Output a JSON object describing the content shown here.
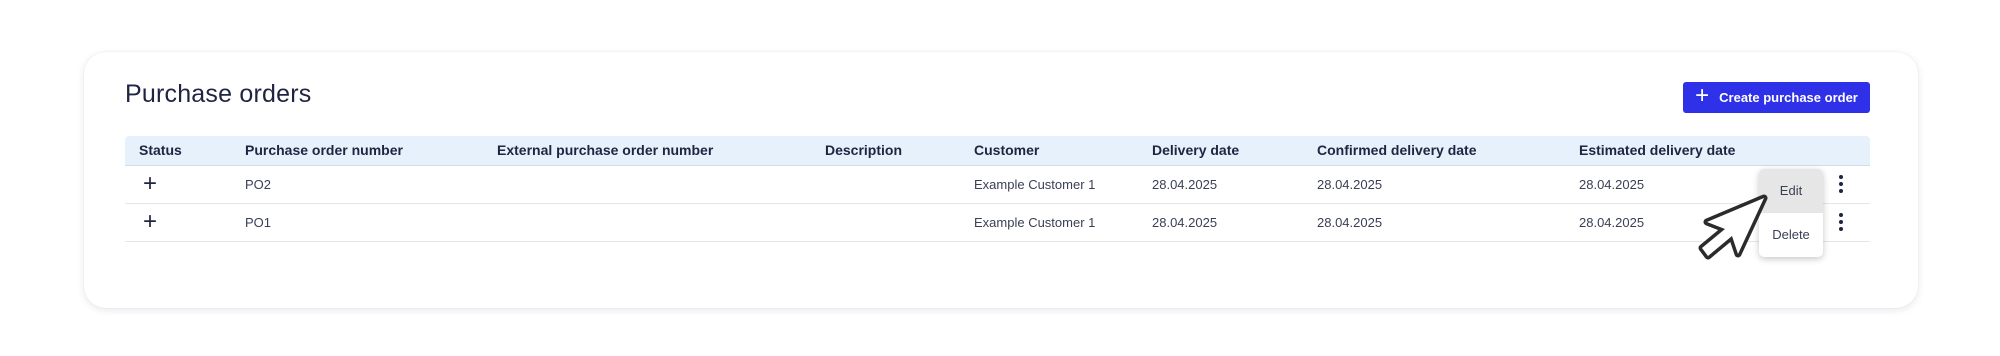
{
  "page": {
    "title": "Purchase orders",
    "create_button_label": "Create purchase order",
    "create_button_icon": "plus-icon"
  },
  "table": {
    "columns": [
      "Status",
      "Purchase order number",
      "External purchase order number",
      "Description",
      "Customer",
      "Delivery date",
      "Confirmed delivery date",
      "Estimated delivery date"
    ],
    "rows": [
      {
        "status_icon": "plus-icon",
        "purchase_order_number": "PO2",
        "external_purchase_order_number": "",
        "description": "",
        "customer": "Example Customer 1",
        "delivery_date": "28.04.2025",
        "confirmed_delivery_date": "28.04.2025",
        "estimated_delivery_date": "28.04.2025"
      },
      {
        "status_icon": "plus-icon",
        "purchase_order_number": "PO1",
        "external_purchase_order_number": "",
        "description": "",
        "customer": "Example Customer 1",
        "delivery_date": "28.04.2025",
        "confirmed_delivery_date": "28.04.2025",
        "estimated_delivery_date": "28.04.2025"
      }
    ]
  },
  "context_menu": {
    "items": [
      "Edit",
      "Delete"
    ],
    "hovered_item": "Edit"
  },
  "colors": {
    "primary": "#2e31e8",
    "header_background": "#e6f1fc",
    "text": "#1f2440"
  }
}
